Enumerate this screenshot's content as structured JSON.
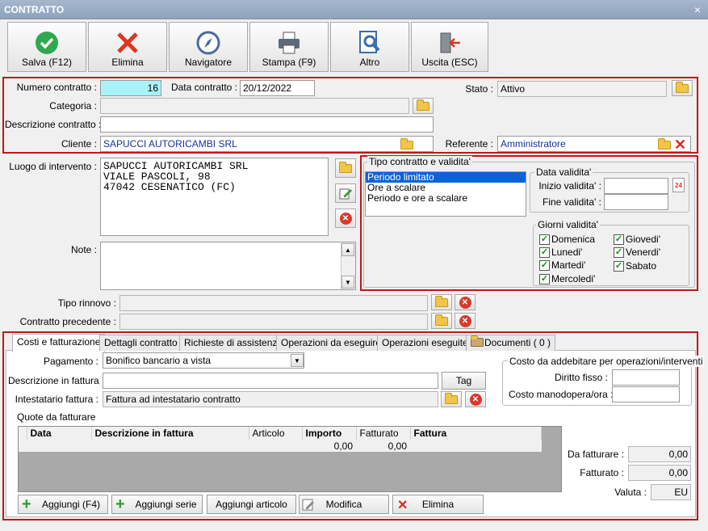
{
  "window": {
    "title": "CONTRATTO",
    "close": "×"
  },
  "toolbar": {
    "save": "Salva (F12)",
    "delete": "Elimina",
    "navigator": "Navigatore",
    "print": "Stampa (F9)",
    "other": "Altro",
    "exit": "Uscita (ESC)"
  },
  "header": {
    "numero_label": "Numero contratto :",
    "numero_value": "16",
    "data_label": "Data contratto :",
    "data_value": "20/12/2022",
    "stato_label": "Stato :",
    "stato_value": "Attivo",
    "categoria_label": "Categoria :",
    "categoria_value": "",
    "descrizione_label": "Descrizione contratto :",
    "descrizione_value": "",
    "cliente_label": "Cliente :",
    "cliente_value": "SAPUCCI AUTORICAMBI SRL",
    "referente_label": "Referente :",
    "referente_value": "Amministratore"
  },
  "luogo": {
    "label": "Luogo di intervento :",
    "lines": [
      "SAPUCCI AUTORICAMBI SRL",
      "VIALE PASCOLI, 98",
      "47042 CESENATICO (FC)"
    ]
  },
  "note": {
    "label": "Note :",
    "value": ""
  },
  "rinnovo": {
    "label": "Tipo rinnovo :",
    "value": ""
  },
  "precedente": {
    "label": "Contratto precedente :",
    "value": ""
  },
  "tipo_contratto": {
    "legend": "Tipo contratto e validita'",
    "options": [
      "Periodo limitato",
      "Ore a scalare",
      "Periodo e ore a scalare"
    ],
    "selected": "Periodo limitato",
    "data_validita": {
      "legend": "Data validita'",
      "inizio_label": "Inizio validita' :",
      "fine_label": "Fine validita' :",
      "inizio_value": "",
      "fine_value": "",
      "calendar_day": "24"
    },
    "giorni": {
      "legend": "Giorni validita'",
      "days": [
        {
          "label": "Domenica",
          "checked": true
        },
        {
          "label": "Lunedi'",
          "checked": true
        },
        {
          "label": "Martedi'",
          "checked": true
        },
        {
          "label": "Mercoledi'",
          "checked": true
        },
        {
          "label": "Giovedi'",
          "checked": true
        },
        {
          "label": "Venerdi'",
          "checked": true
        },
        {
          "label": "Sabato",
          "checked": true
        }
      ]
    }
  },
  "tabs": [
    {
      "label": "Costi e fatturazione",
      "active": true
    },
    {
      "label": "Dettagli contratto"
    },
    {
      "label": "Richieste di assistenza"
    },
    {
      "label": "Operazioni da eseguire"
    },
    {
      "label": "Operazioni eseguite"
    },
    {
      "label": "Documenti ( 0 )"
    }
  ],
  "costi": {
    "pagamento_label": "Pagamento :",
    "pagamento_value": "Bonifico bancario a vista",
    "descr_fattura_label": "Descrizione in fattura",
    "descr_fattura_value": "",
    "tag_button": "Tag",
    "intestatario_label": "Intestatario fattura :",
    "intestatario_value": "Fattura ad intestatario contratto",
    "costo_legend": "Costo da addebitare per operazioni/interventi",
    "diritto_label": "Diritto fisso :",
    "diritto_value": "",
    "manodopera_label": "Costo manodopera/ora :",
    "manodopera_value": "",
    "quote_label": "Quote da fatturare",
    "grid_headers": [
      "Data",
      "Descrizione in fattura",
      "Articolo",
      "Importo",
      "Fatturato",
      "Fattura"
    ],
    "grid_totals": {
      "importo": "0,00",
      "fatturato": "0,00"
    },
    "da_fatturare_label": "Da fatturare :",
    "da_fatturare_value": "0,00",
    "fatturato_label": "Fatturato :",
    "fatturato_value": "0,00",
    "valuta_label": "Valuta :",
    "valuta_value": "EU",
    "buttons": {
      "aggiungi": "Aggiungi (F4)",
      "aggiungi_serie": "Aggiungi serie",
      "aggiungi_articolo": "Aggiungi articolo",
      "modifica": "Modifica",
      "elimina": "Elimina"
    }
  },
  "colors": {
    "highlight_border": "#c0161b",
    "selection": "#0a64d8",
    "numero_bg": "#a8f3fa",
    "link_text": "#1530a0"
  }
}
